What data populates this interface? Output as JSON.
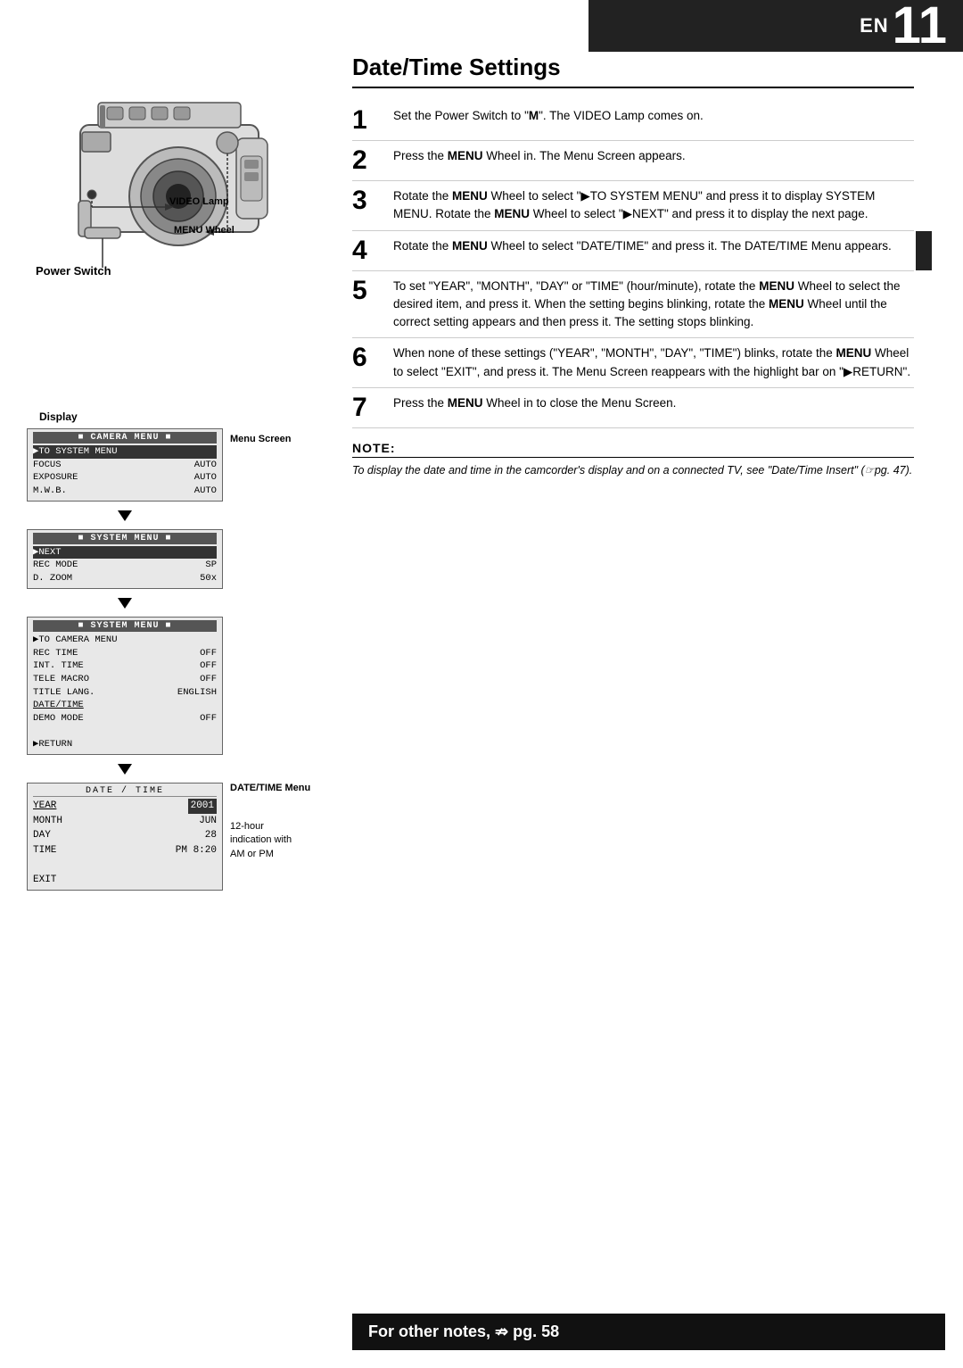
{
  "header": {
    "en_label": "EN",
    "page_number": "11"
  },
  "camera_labels": {
    "video_lamp": "VIDEO Lamp",
    "menu_wheel": "MENU Wheel",
    "power_switch": "Power Switch",
    "display": "Display",
    "menu_screen": "Menu Screen",
    "datetime_menu": "DATE/TIME Menu",
    "hour_annotation": "12-hour\nindication with\nAM or PM"
  },
  "menu_screen_1": {
    "title": "CAMERA MENU",
    "rows": [
      {
        "label": "▶TO SYSTEM MENU",
        "value": "",
        "highlight": true
      },
      {
        "label": "FOCUS",
        "value": "AUTO"
      },
      {
        "label": "EXPOSURE",
        "value": "AUTO"
      },
      {
        "label": "M.W.B.",
        "value": "AUTO"
      }
    ]
  },
  "menu_screen_2": {
    "title": "SYSTEM MENU",
    "rows": [
      {
        "label": "▶NEXT",
        "value": "",
        "highlight": true
      },
      {
        "label": "REC MODE",
        "value": "SP"
      },
      {
        "label": "D. ZOOM",
        "value": "50x"
      }
    ]
  },
  "menu_screen_3": {
    "title": "SYSTEM MENU",
    "rows": [
      {
        "label": "▶TO CAMERA MENU",
        "value": ""
      },
      {
        "label": "REC TIME",
        "value": "OFF"
      },
      {
        "label": "INT. TIME",
        "value": "OFF"
      },
      {
        "label": "TELE MACRO",
        "value": "OFF"
      },
      {
        "label": "TITLE LANG.",
        "value": "ENGLISH"
      },
      {
        "label": "DATE/TIME",
        "value": "",
        "underline": true
      },
      {
        "label": "DEMO MODE",
        "value": "OFF"
      },
      {
        "label": "",
        "value": ""
      },
      {
        "label": "▶RETURN",
        "value": ""
      }
    ]
  },
  "datetime_menu": {
    "title": "DATE / TIME",
    "rows": [
      {
        "label": "YEAR",
        "value": "2001",
        "label_underline": true,
        "value_highlight": true
      },
      {
        "label": "MONTH",
        "value": "JUN"
      },
      {
        "label": "DAY",
        "value": "28"
      },
      {
        "label": "TIME",
        "value": "PM 8:20"
      },
      {
        "label": "",
        "value": ""
      },
      {
        "label": "EXIT",
        "value": ""
      }
    ]
  },
  "page_title": "Date/Time Settings",
  "steps": [
    {
      "number": "1",
      "text": "Set the Power Switch to \"Ⓜ\". The VIDEO Lamp comes on."
    },
    {
      "number": "2",
      "text": "Press the MENU Wheel in. The Menu Screen appears."
    },
    {
      "number": "3",
      "text": "Rotate the MENU Wheel to select \"▶TO SYSTEM MENU\" and press it to display SYSTEM MENU. Rotate the MENU Wheel to select \"▶NEXT\" and press it to display the next page."
    },
    {
      "number": "4",
      "text": "Rotate the MENU Wheel to select “DATE/TIME” and press it. The DATE/TIME Menu appears."
    },
    {
      "number": "5",
      "text": "To set “YEAR”, “MONTH”, “DAY” or “TIME” (hour/minute), rotate the MENU Wheel to select the desired item, and press it. When the setting begins blinking, rotate the MENU Wheel until the correct setting appears and then press it. The setting stops blinking."
    },
    {
      "number": "6",
      "text": "When none of these settings (“YEAR”, “MONTH”, “DAY”, “TIME”) blinks, rotate the MENU Wheel to select “EXIT”, and press it. The Menu Screen reappears with the highlight bar on “▶RETURN”."
    },
    {
      "number": "7",
      "text": "Press the MENU Wheel in to close the Menu Screen."
    }
  ],
  "note": {
    "title": "NOTE:",
    "text": "To display the date and time in the camcorder’s display and on a connected TV, see “Date/Time Insert” (⇏pg. 47)."
  },
  "footer": {
    "text": "For other notes,  ⇏ pg. 58"
  }
}
